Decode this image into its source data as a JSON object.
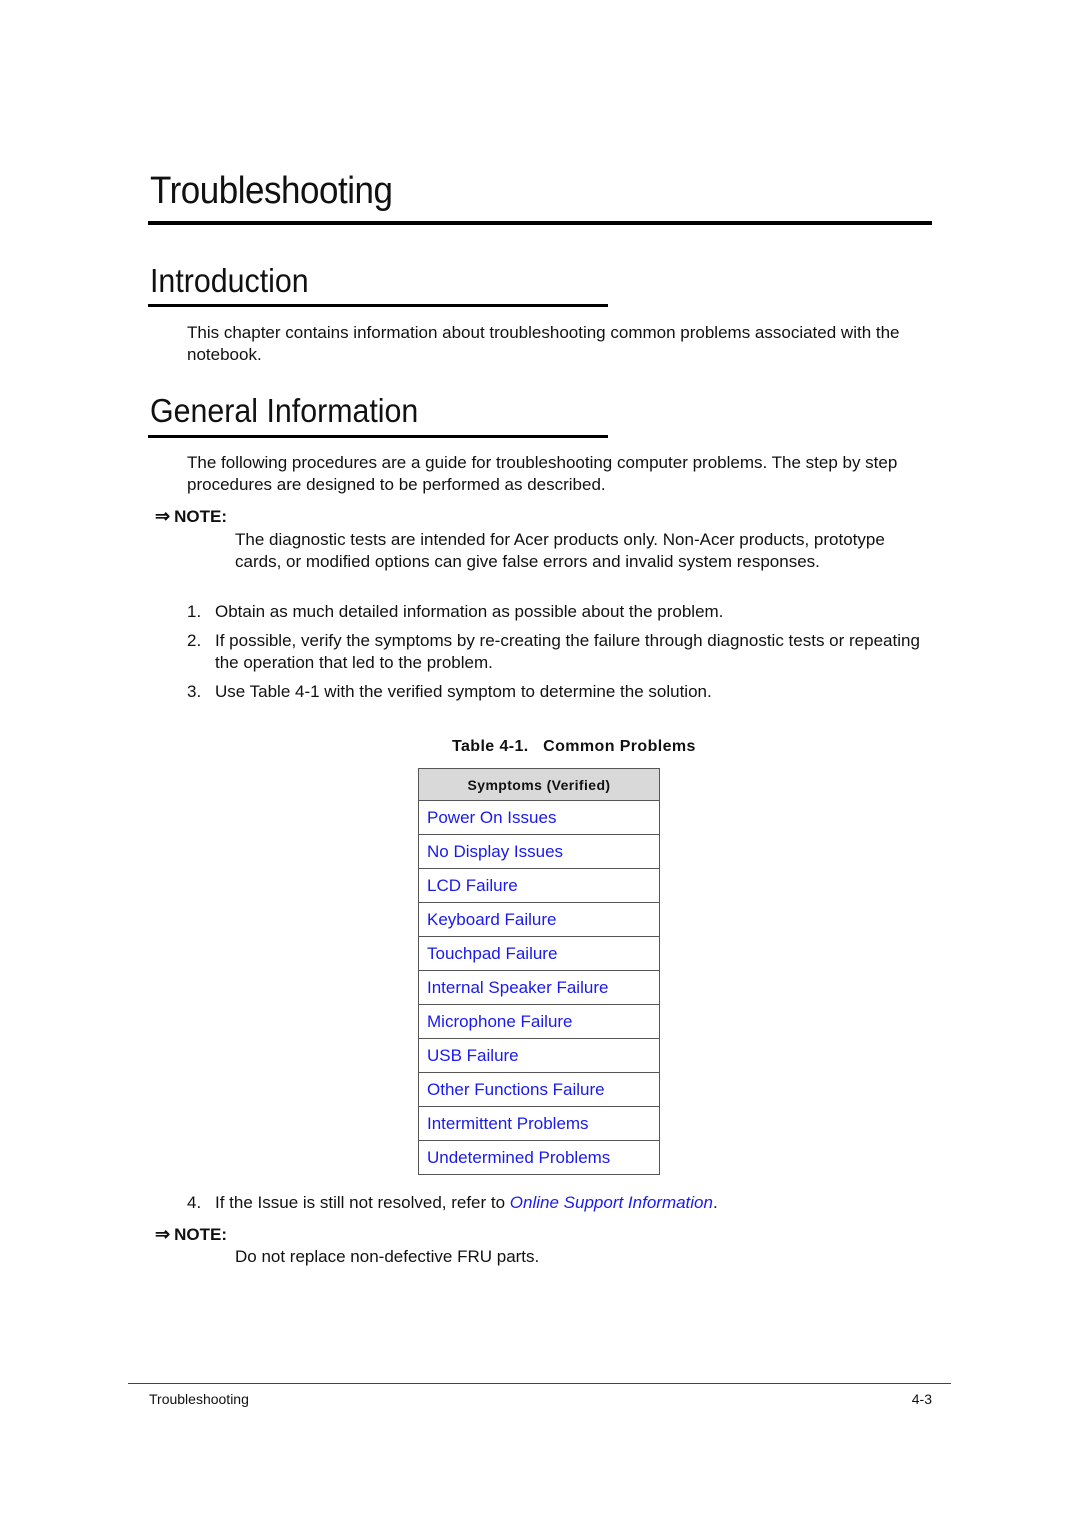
{
  "page": {
    "chapter_title": "Troubleshooting",
    "sections": [
      {
        "heading": "Introduction",
        "body": "This chapter contains information about troubleshooting common problems associated with the notebook."
      },
      {
        "heading": "General Information",
        "body": "The following procedures are a guide for troubleshooting computer problems. The step by step procedures are designed to be performed as described."
      }
    ],
    "notes": [
      {
        "label": "NOTE:",
        "icon": "arrow-right-icon",
        "text": "The diagnostic tests are intended for Acer products only. Non-Acer products, prototype cards, or modified options can give false errors and invalid system responses."
      },
      {
        "label": "NOTE:",
        "icon": "arrow-right-icon",
        "text": "Do not replace non-defective FRU parts."
      }
    ],
    "steps": [
      {
        "num": "1.",
        "text": "Obtain as much detailed information as possible about the problem."
      },
      {
        "num": "2.",
        "text": "If possible, verify the symptoms by re-creating the failure through diagnostic tests or repeating the operation that led to the problem."
      },
      {
        "num": "3.",
        "text": "Use Table 4-1 with the verified symptom to determine the solution."
      },
      {
        "num": "4.",
        "text_before": "If the Issue is still not resolved, refer to ",
        "link": "Online Support Information",
        "text_after": "."
      }
    ],
    "table": {
      "caption": "Table 4-1.   Common Problems",
      "header": "Symptoms (Verified)",
      "rows": [
        "Power On Issues",
        "No Display Issues",
        "LCD Failure",
        "Keyboard Failure",
        "Touchpad Failure",
        "Internal Speaker Failure",
        "Microphone Failure",
        "USB Failure",
        "Other Functions Failure",
        "Intermittent Problems",
        "Undetermined Problems"
      ]
    },
    "footer": {
      "left": "Troubleshooting",
      "right": "4-3"
    },
    "colors": {
      "link": "#1a1aee",
      "table_header_bg": "#d9d9d9"
    }
  }
}
